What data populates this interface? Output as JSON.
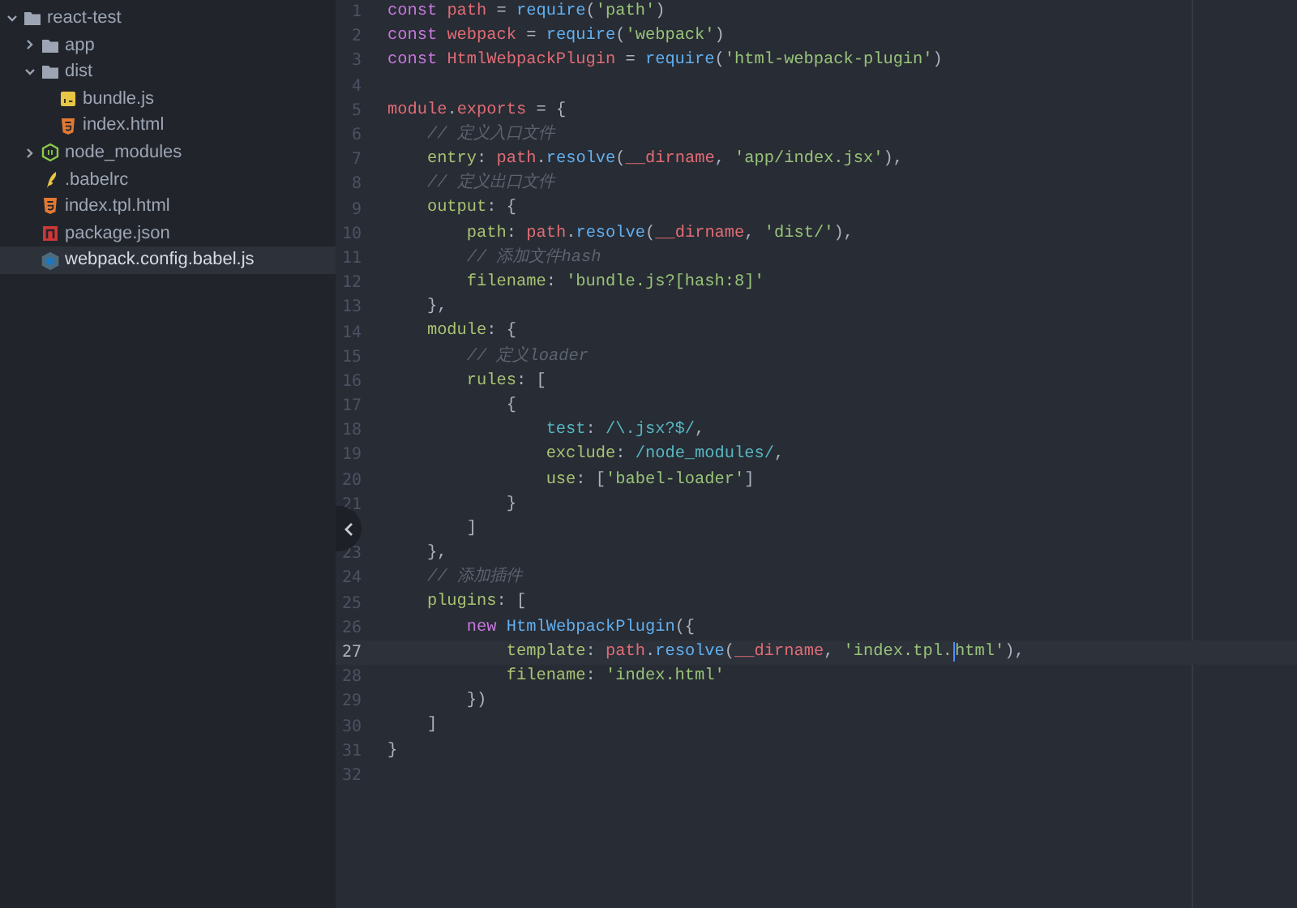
{
  "sidebar": {
    "tree": [
      {
        "label": "react-test",
        "kind": "folder",
        "expanded": true,
        "selected": false,
        "children": [
          {
            "label": "app",
            "kind": "folder",
            "expanded": false,
            "selected": false
          },
          {
            "label": "dist",
            "kind": "folder",
            "expanded": true,
            "selected": false,
            "children": [
              {
                "label": "bundle.js",
                "kind": "js",
                "selected": false
              },
              {
                "label": "index.html",
                "kind": "html",
                "selected": false
              }
            ]
          },
          {
            "label": "node_modules",
            "kind": "node-folder",
            "expanded": false,
            "selected": false
          },
          {
            "label": ".babelrc",
            "kind": "babel",
            "selected": false
          },
          {
            "label": "index.tpl.html",
            "kind": "html",
            "selected": false
          },
          {
            "label": "package.json",
            "kind": "npm",
            "selected": false
          },
          {
            "label": "webpack.config.babel.js",
            "kind": "webpack",
            "selected": true
          }
        ]
      }
    ]
  },
  "editor": {
    "lines": [
      {
        "number": "1",
        "current": false,
        "tokens": [
          {
            "kind": "keyword",
            "text": "const "
          },
          {
            "kind": "variable",
            "text": "path"
          },
          {
            "kind": "punct",
            "text": " = "
          },
          {
            "kind": "function",
            "text": "require"
          },
          {
            "kind": "punct",
            "text": "("
          },
          {
            "kind": "string",
            "text": "'path'"
          },
          {
            "kind": "punct",
            "text": ")"
          }
        ]
      },
      {
        "number": "2",
        "current": false,
        "tokens": [
          {
            "kind": "keyword",
            "text": "const "
          },
          {
            "kind": "variable",
            "text": "webpack"
          },
          {
            "kind": "punct",
            "text": " = "
          },
          {
            "kind": "function",
            "text": "require"
          },
          {
            "kind": "punct",
            "text": "("
          },
          {
            "kind": "string",
            "text": "'webpack'"
          },
          {
            "kind": "punct",
            "text": ")"
          }
        ]
      },
      {
        "number": "3",
        "current": false,
        "tokens": [
          {
            "kind": "keyword",
            "text": "const "
          },
          {
            "kind": "variable",
            "text": "HtmlWebpackPlugin"
          },
          {
            "kind": "punct",
            "text": " = "
          },
          {
            "kind": "function",
            "text": "require"
          },
          {
            "kind": "punct",
            "text": "("
          },
          {
            "kind": "string",
            "text": "'html-webpack-plugin'"
          },
          {
            "kind": "punct",
            "text": ")"
          }
        ]
      },
      {
        "number": "4",
        "current": false
      },
      {
        "number": "5",
        "current": false,
        "tokens": [
          {
            "kind": "variable",
            "text": "module"
          },
          {
            "kind": "punct",
            "text": "."
          },
          {
            "kind": "variable",
            "text": "exports"
          },
          {
            "kind": "punct",
            "text": " = {"
          }
        ]
      },
      {
        "number": "6",
        "current": false,
        "tokens": [
          {
            "kind": "comment",
            "text": "    // 定义入口文件"
          }
        ]
      },
      {
        "number": "7",
        "current": false,
        "tokens": [
          {
            "kind": "property",
            "text": "    entry"
          },
          {
            "kind": "punct",
            "text": ": "
          },
          {
            "kind": "variable",
            "text": "path"
          },
          {
            "kind": "punct",
            "text": "."
          },
          {
            "kind": "function",
            "text": "resolve"
          },
          {
            "kind": "punct",
            "text": "("
          },
          {
            "kind": "variable",
            "text": "__dirname"
          },
          {
            "kind": "punct",
            "text": ", "
          },
          {
            "kind": "string",
            "text": "'app/index.jsx'"
          },
          {
            "kind": "punct",
            "text": "),"
          }
        ]
      },
      {
        "number": "8",
        "current": false,
        "tokens": [
          {
            "kind": "comment",
            "text": "    // 定义出口文件"
          }
        ]
      },
      {
        "number": "9",
        "current": false,
        "tokens": [
          {
            "kind": "property",
            "text": "    output"
          },
          {
            "kind": "punct",
            "text": ": {"
          }
        ]
      },
      {
        "number": "10",
        "current": false,
        "tokens": [
          {
            "kind": "property",
            "text": "        path"
          },
          {
            "kind": "punct",
            "text": ": "
          },
          {
            "kind": "variable",
            "text": "path"
          },
          {
            "kind": "punct",
            "text": "."
          },
          {
            "kind": "function",
            "text": "resolve"
          },
          {
            "kind": "punct",
            "text": "("
          },
          {
            "kind": "variable",
            "text": "__dirname"
          },
          {
            "kind": "punct",
            "text": ", "
          },
          {
            "kind": "string",
            "text": "'dist/'"
          },
          {
            "kind": "punct",
            "text": "),"
          }
        ]
      },
      {
        "number": "11",
        "current": false,
        "tokens": [
          {
            "kind": "comment",
            "text": "        // 添加文件hash"
          }
        ]
      },
      {
        "number": "12",
        "current": false,
        "tokens": [
          {
            "kind": "property",
            "text": "        filename"
          },
          {
            "kind": "punct",
            "text": ": "
          },
          {
            "kind": "string",
            "text": "'bundle.js?[hash:8]'"
          }
        ]
      },
      {
        "number": "13",
        "current": false,
        "tokens": [
          {
            "kind": "punct",
            "text": "    },"
          }
        ]
      },
      {
        "number": "14",
        "current": false,
        "tokens": [
          {
            "kind": "property",
            "text": "    module"
          },
          {
            "kind": "punct",
            "text": ": {"
          }
        ]
      },
      {
        "number": "15",
        "current": false,
        "tokens": [
          {
            "kind": "comment",
            "text": "        // 定义loader"
          }
        ]
      },
      {
        "number": "16",
        "current": false,
        "tokens": [
          {
            "kind": "property",
            "text": "        rules"
          },
          {
            "kind": "punct",
            "text": ": ["
          }
        ]
      },
      {
        "number": "17",
        "current": false,
        "tokens": [
          {
            "kind": "punct",
            "text": "            {"
          }
        ]
      },
      {
        "number": "18",
        "current": false,
        "tokens": [
          {
            "kind": "regex",
            "text": "                test"
          },
          {
            "kind": "punct",
            "text": ": "
          },
          {
            "kind": "regex",
            "text": "/\\.jsx?$/"
          },
          {
            "kind": "punct",
            "text": ","
          }
        ]
      },
      {
        "number": "19",
        "current": false,
        "tokens": [
          {
            "kind": "property",
            "text": "                exclude"
          },
          {
            "kind": "punct",
            "text": ": "
          },
          {
            "kind": "regex",
            "text": "/node_modules/"
          },
          {
            "kind": "punct",
            "text": ","
          }
        ]
      },
      {
        "number": "20",
        "current": false,
        "tokens": [
          {
            "kind": "property",
            "text": "                use"
          },
          {
            "kind": "punct",
            "text": ": ["
          },
          {
            "kind": "string",
            "text": "'babel-loader'"
          },
          {
            "kind": "punct",
            "text": "]"
          }
        ]
      },
      {
        "number": "21",
        "current": false,
        "tokens": [
          {
            "kind": "punct",
            "text": "            }"
          }
        ]
      },
      {
        "tokens": [
          {
            "kind": "punct",
            "text": "        ]"
          }
        ]
      },
      {
        "number": "23",
        "current": false,
        "tokens": [
          {
            "kind": "punct",
            "text": "    },"
          }
        ]
      },
      {
        "number": "24",
        "current": false,
        "tokens": [
          {
            "kind": "comment",
            "text": "    // 添加插件"
          }
        ]
      },
      {
        "number": "25",
        "current": false,
        "tokens": [
          {
            "kind": "property",
            "text": "    plugins"
          },
          {
            "kind": "punct",
            "text": ": ["
          }
        ]
      },
      {
        "number": "26",
        "current": false,
        "tokens": [
          {
            "kind": "keyword",
            "text": "        new "
          },
          {
            "kind": "function",
            "text": "HtmlWebpackPlugin"
          },
          {
            "kind": "punct",
            "text": "({"
          }
        ]
      },
      {
        "number": "27",
        "current": true,
        "tokens": [
          {
            "kind": "property",
            "text": "            template"
          },
          {
            "kind": "punct",
            "text": ": "
          },
          {
            "kind": "variable",
            "text": "path"
          },
          {
            "kind": "punct",
            "text": "."
          },
          {
            "kind": "function",
            "text": "resolve"
          },
          {
            "kind": "punct",
            "text": "("
          },
          {
            "kind": "variable",
            "text": "__dirname"
          },
          {
            "kind": "punct",
            "text": ", "
          },
          {
            "kind": "string",
            "text": "'index.tpl."
          },
          {
            "kind": "string",
            "text": "html'",
            "cursor_before": true
          },
          {
            "kind": "punct",
            "text": "),"
          }
        ]
      },
      {
        "number": "28",
        "current": false,
        "tokens": [
          {
            "kind": "property",
            "text": "            filename"
          },
          {
            "kind": "punct",
            "text": ": "
          },
          {
            "kind": "string",
            "text": "'index.html'"
          }
        ]
      },
      {
        "number": "29",
        "current": false,
        "tokens": [
          {
            "kind": "punct",
            "text": "        })"
          }
        ]
      },
      {
        "number": "30",
        "current": false,
        "tokens": [
          {
            "kind": "punct",
            "text": "    ]"
          }
        ]
      },
      {
        "number": "31",
        "current": false,
        "tokens": [
          {
            "kind": "punct",
            "text": "}"
          }
        ]
      },
      {
        "number": "32",
        "current": false
      }
    ]
  }
}
